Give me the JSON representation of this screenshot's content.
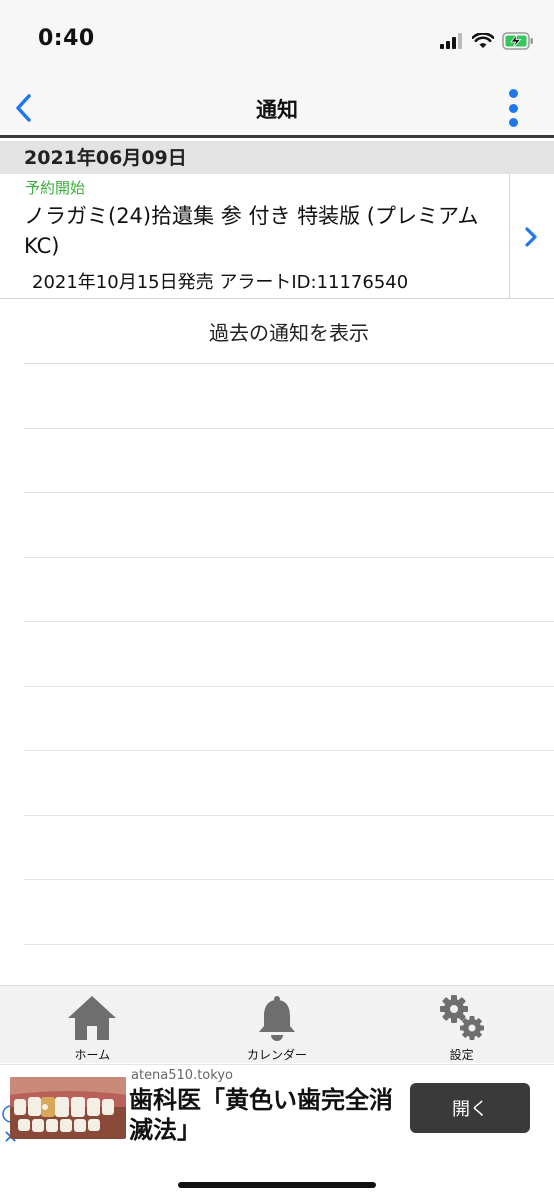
{
  "status_bar": {
    "time": "0:40"
  },
  "nav": {
    "title": "通知",
    "accent_color": "#1f77e8"
  },
  "section": {
    "date": "2021年06月09日"
  },
  "notification": {
    "status": "予約開始",
    "status_color": "#3bae3b",
    "title": "ノラガミ(24)拾遺集 参 付き 特装版 (プレミアムKC)",
    "meta": "2021年10月15日発売 アラートID:11176540"
  },
  "past_notifications_label": "過去の通知を表示",
  "tab_bar": {
    "items": [
      {
        "label": "ホーム",
        "icon": "home-icon"
      },
      {
        "label": "カレンダー",
        "icon": "bell-icon"
      },
      {
        "label": "設定",
        "icon": "gear-icon"
      }
    ]
  },
  "ad": {
    "domain": "atena510.tokyo",
    "headline": "歯科医「黄色い歯完全消滅法」",
    "button_label": "開く"
  }
}
